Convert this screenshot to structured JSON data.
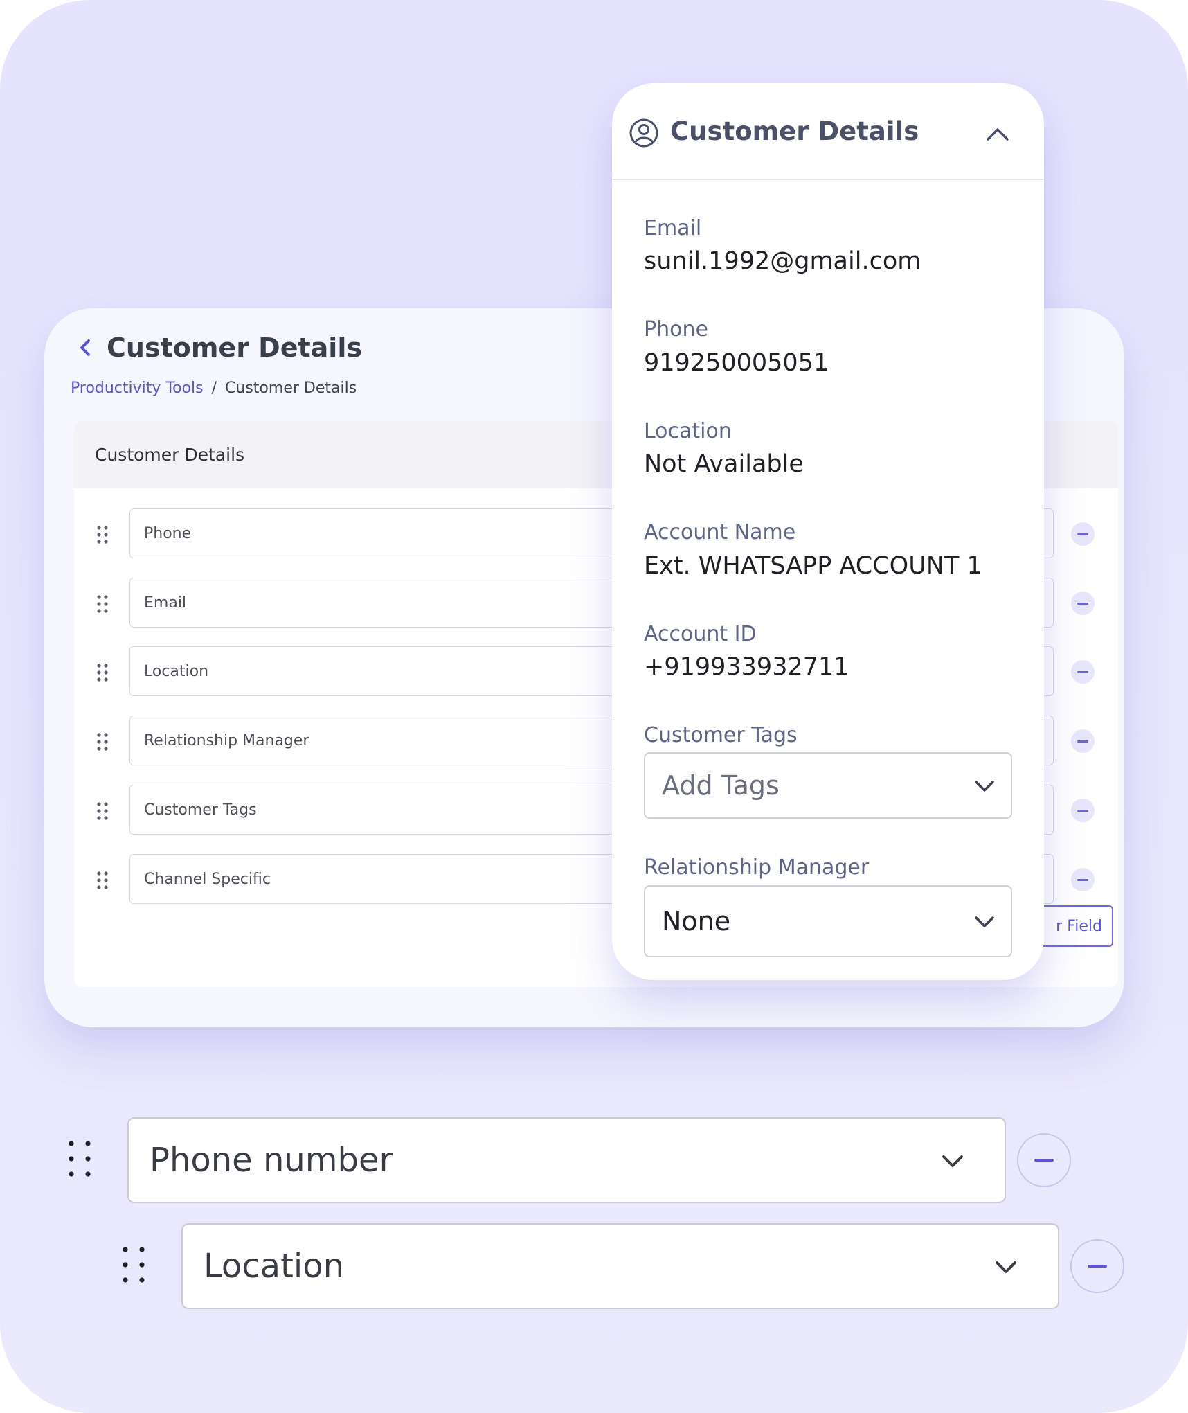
{
  "back_card": {
    "title": "Customer Details",
    "breadcrumb": {
      "link": "Productivity Tools",
      "separator": "/",
      "current": "Customer Details"
    },
    "panel_title": "Customer Details",
    "fields": [
      "Phone",
      "Email",
      "Location",
      "Relationship Manager",
      "Customer Tags",
      "Channel Specific"
    ],
    "add_field_label": "r Field"
  },
  "popover": {
    "title": "Customer Details",
    "email_label": "Email",
    "email_value": "sunil.1992@gmail.com",
    "phone_label": "Phone",
    "phone_value": "919250005051",
    "location_label": "Location",
    "location_value": "Not Available",
    "account_name_label": "Account Name",
    "account_name_value": "Ext. WHATSAPP ACCOUNT 1",
    "account_id_label": "Account ID",
    "account_id_value": "+919933932711",
    "tags_label": "Customer Tags",
    "tags_placeholder": "Add Tags",
    "rm_label": "Relationship Manager",
    "rm_value": "None"
  },
  "bottom_rows": [
    {
      "value": "Phone number"
    },
    {
      "value": "Location"
    }
  ],
  "colors": {
    "accent": "#5b55d6",
    "background": "#e5e3fd",
    "text_dark": "#1f2127",
    "label": "#5d6586"
  },
  "icons": [
    "back-chevron-icon",
    "user-circle-icon",
    "chevron-up-icon",
    "chevron-down-icon",
    "drag-handle-icon",
    "minus-icon"
  ]
}
